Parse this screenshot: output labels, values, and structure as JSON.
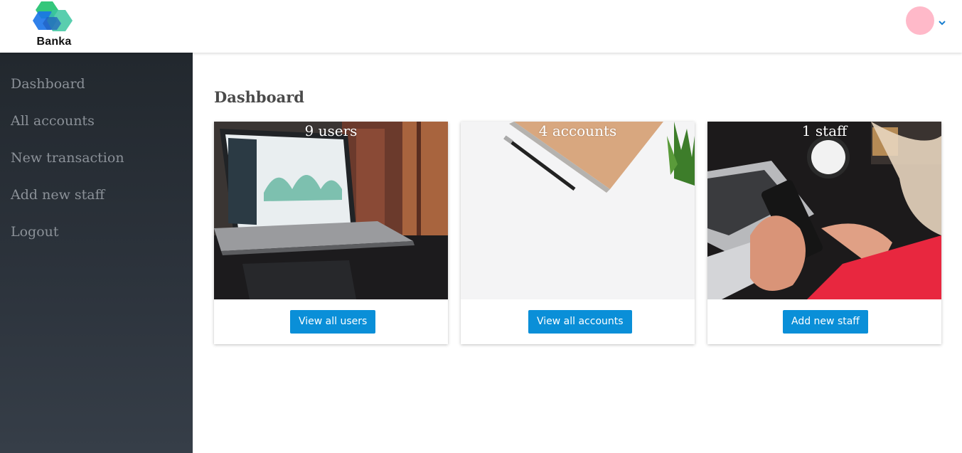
{
  "brand": {
    "name": "Banka",
    "logo_icon": "hexagon-logo-icon"
  },
  "header": {
    "avatar_color": "#ffb9c9",
    "menu_icon": "chevron-down-icon"
  },
  "sidebar": {
    "items": [
      {
        "label": "Dashboard"
      },
      {
        "label": "All accounts"
      },
      {
        "label": "New transaction"
      },
      {
        "label": "Add new staff"
      },
      {
        "label": "Logout"
      }
    ]
  },
  "main": {
    "title": "Dashboard",
    "cards": [
      {
        "count": "9 users",
        "button": "View all users"
      },
      {
        "count": "4 accounts",
        "button": "View all accounts"
      },
      {
        "count": "1 staff",
        "button": "Add new staff"
      }
    ]
  },
  "colors": {
    "accent": "#0a8fd8",
    "sidebar": "#2a3038"
  }
}
